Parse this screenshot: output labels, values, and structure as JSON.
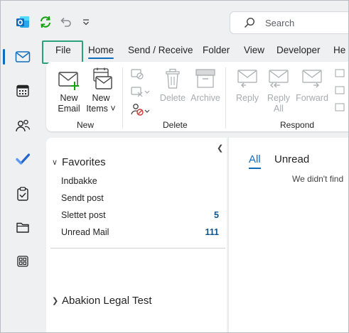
{
  "titlebar": {
    "app_icon": "outlook-icon",
    "sync_icon": "sync-icon",
    "undo_icon": "undo-icon",
    "customize_icon": "customize-quick-access-icon",
    "search_placeholder": "Search"
  },
  "rail": [
    {
      "icon": "mail-icon",
      "active": true
    },
    {
      "icon": "calendar-icon"
    },
    {
      "icon": "people-icon"
    },
    {
      "icon": "todo-icon"
    },
    {
      "icon": "tasks-icon"
    },
    {
      "icon": "folder-icon"
    },
    {
      "icon": "apps-icon"
    }
  ],
  "menu": {
    "tabs": [
      "File",
      "Home",
      "Send / Receive",
      "Folder",
      "View",
      "Developer",
      "He"
    ],
    "active": "Home",
    "highlighted": "File"
  },
  "ribbon": {
    "new": {
      "new_email": [
        "New",
        "Email"
      ],
      "new_items": [
        "New",
        "Items ˅"
      ],
      "label": "New"
    },
    "delete": {
      "delete": "Delete",
      "archive": "Archive",
      "label": "Delete"
    },
    "respond": {
      "reply": "Reply",
      "reply_all": [
        "Reply",
        "All"
      ],
      "forward": "Forward",
      "label": "Respond"
    }
  },
  "folders": {
    "favorites_label": "Favorites",
    "items": [
      {
        "name": "Indbakke",
        "count": ""
      },
      {
        "name": "Sendt post",
        "count": ""
      },
      {
        "name": "Slettet post",
        "count": "5"
      },
      {
        "name": "Unread Mail",
        "count": "111"
      }
    ],
    "account_label": "Abakion Legal Test"
  },
  "message_list": {
    "tabs": [
      "All",
      "Unread"
    ],
    "active_tab": "All",
    "empty_text": "We didn't find"
  },
  "colors": {
    "accent": "#0f6cbd",
    "highlight_box": "#2aa17b"
  }
}
